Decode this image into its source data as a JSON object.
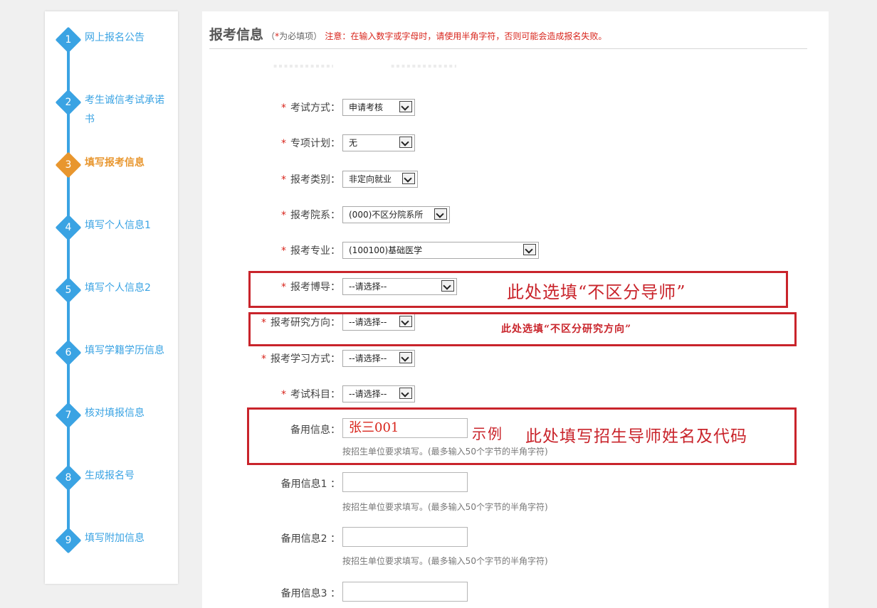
{
  "steps": [
    {
      "num": "1",
      "label": "网上报名公告"
    },
    {
      "num": "2",
      "label": "考生诚信考试承诺书"
    },
    {
      "num": "3",
      "label": "填写报考信息"
    },
    {
      "num": "4",
      "label": "填写个人信息1"
    },
    {
      "num": "5",
      "label": "填写个人信息2"
    },
    {
      "num": "6",
      "label": "填写学籍学历信息"
    },
    {
      "num": "7",
      "label": "核对填报信息"
    },
    {
      "num": "8",
      "label": "生成报名号"
    },
    {
      "num": "9",
      "label": "填写附加信息"
    }
  ],
  "header": {
    "title": "报考信息",
    "required_prefix": "（",
    "required_star": "*",
    "required_text": "为必填项）",
    "note": "注意：在输入数字或字母时，请使用半角字符，否则可能会造成报名失败。"
  },
  "fields": {
    "exam_mode": {
      "star": "*",
      "label": "考试方式：",
      "value": "申请考核"
    },
    "special_plan": {
      "star": "*",
      "label": "专项计划：",
      "value": "无"
    },
    "category": {
      "star": "*",
      "label": "报考类别：",
      "value": "非定向就业"
    },
    "department": {
      "star": "*",
      "label": "报考院系：",
      "value": "(000)不区分院系所"
    },
    "major": {
      "star": "*",
      "label": "报考专业：",
      "value": "(100100)基础医学"
    },
    "supervisor": {
      "star": "*",
      "label": "报考博导：",
      "value": "--请选择--"
    },
    "direction": {
      "star": "*",
      "label": "报考研究方向：",
      "value": "--请选择--"
    },
    "study_mode": {
      "star": "*",
      "label": "报考学习方式：",
      "value": "--请选择--"
    },
    "subjects": {
      "star": "*",
      "label": "考试科目：",
      "value": "--请选择--"
    },
    "backup": {
      "label": "备用信息：",
      "value": "张三001",
      "hint": "按招生单位要求填写。(最多输入50个字节的半角字符)"
    },
    "backup1": {
      "label": "备用信息1 ：",
      "value": "",
      "hint": "按招生单位要求填写。(最多输入50个字节的半角字符)"
    },
    "backup2": {
      "label": "备用信息2 ：",
      "value": "",
      "hint": "按招生单位要求填写。(最多输入50个字节的半角字符)"
    },
    "backup3": {
      "label": "备用信息3 ：",
      "value": ""
    }
  },
  "annotations": {
    "supervisor": "此处选填“不区分导师”",
    "direction": "此处选填“不区分研究方向”",
    "example": "示例",
    "backup": "此处填写招生导师姓名及代码"
  },
  "colors": {
    "accent": "#3aa3e3",
    "active": "#e8962e",
    "required": "#d8251c",
    "annotation": "#c9242b"
  }
}
